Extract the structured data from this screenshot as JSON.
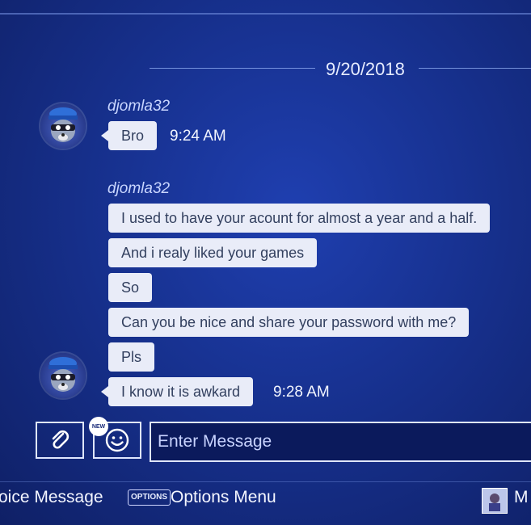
{
  "conversation": {
    "date": "9/20/2018",
    "groups": [
      {
        "sender": "djomla32",
        "messages": [
          "Bro"
        ],
        "time": "9:24 AM"
      },
      {
        "sender": "djomla32",
        "messages": [
          "I used to have your acount for almost a year  and a half.",
          "And i realy liked your games",
          "So",
          "Can you be nice and share your password with me?",
          "Pls",
          "I know it is awkard"
        ],
        "time": "9:28 AM"
      }
    ]
  },
  "composer": {
    "attach_icon": "paperclip-icon",
    "emoji_icon": "smiley-icon",
    "emoji_badge": "NEW",
    "placeholder": "Enter Message"
  },
  "footer": {
    "voice_label": "oice Message",
    "options_key": "OPTIONS",
    "options_label": "Options Menu",
    "profile_label_truncated": "M"
  },
  "colors": {
    "background": "#17318f",
    "bubble": "#e9ecf8",
    "bubble_text": "#33405f"
  }
}
